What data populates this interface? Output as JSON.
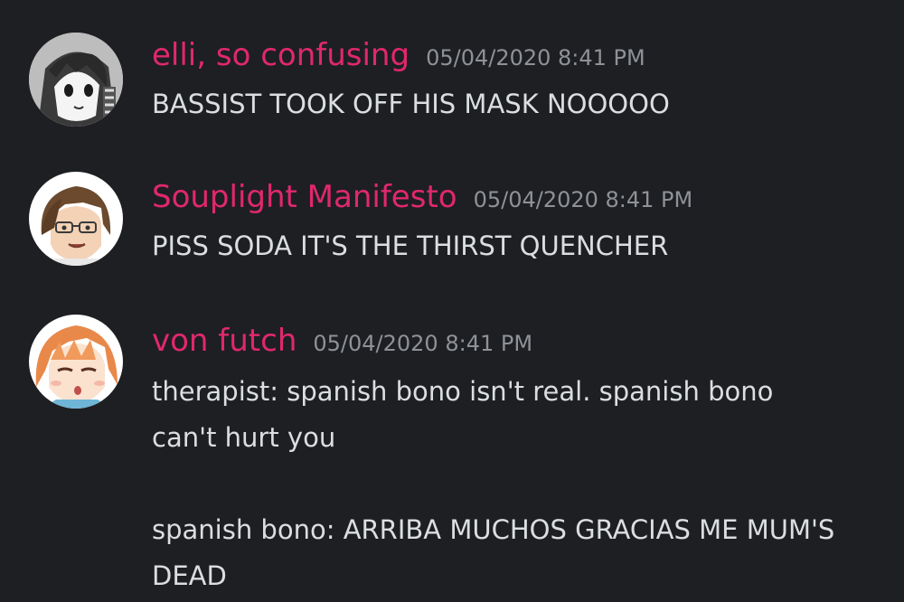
{
  "messages": [
    {
      "username": "elli, so confusing",
      "timestamp": "05/04/2020 8:41 PM",
      "avatar_icon": "manga-character-avatar",
      "lines": [
        "BASSIST TOOK OFF HIS MASK NOOOOO"
      ]
    },
    {
      "username": "Souplight Manifesto",
      "timestamp": "05/04/2020 8:41 PM",
      "avatar_icon": "anime-character-glasses-avatar",
      "lines": [
        "PISS SODA IT'S THE THIRST QUENCHER"
      ]
    },
    {
      "username": "von futch",
      "timestamp": "05/04/2020 8:41 PM",
      "avatar_icon": "anime-character-orange-hair-avatar",
      "lines": [
        "therapist: spanish bono isn't real. spanish bono can't hurt you",
        "spanish bono: ARRIBA MUCHOS GRACIAS ME MUM'S DEAD"
      ]
    }
  ],
  "colors": {
    "background": "#1e1f22",
    "username": "#e0286e",
    "timestamp": "#8e9297",
    "text": "#dbdee1"
  }
}
